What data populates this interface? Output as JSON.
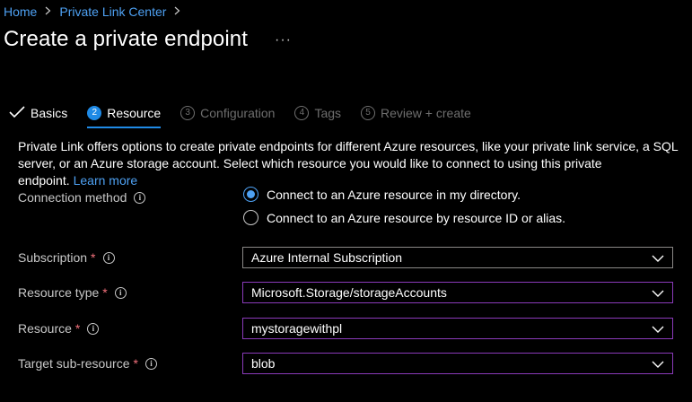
{
  "breadcrumb": {
    "home": "Home",
    "parent": "Private Link Center",
    "sep": ">"
  },
  "page": {
    "title": "Create a private endpoint",
    "more": "···"
  },
  "tabs": [
    {
      "label": "Basics",
      "step": "",
      "state": "done"
    },
    {
      "label": "Resource",
      "step": "2",
      "state": "active"
    },
    {
      "label": "Configuration",
      "step": "3",
      "state": "disabled"
    },
    {
      "label": "Tags",
      "step": "4",
      "state": "disabled"
    },
    {
      "label": "Review + create",
      "step": "5",
      "state": "disabled"
    }
  ],
  "description": {
    "text": "Private Link offers options to create private endpoints for different Azure resources, like your private link service, a SQL server, or an Azure storage account. Select which resource you would like to connect to using this private endpoint.",
    "link": "Learn more"
  },
  "connection_method": {
    "label": "Connection method",
    "options": [
      {
        "label": "Connect to an Azure resource in my directory.",
        "selected": true
      },
      {
        "label": "Connect to an Azure resource by resource ID or alias.",
        "selected": false
      }
    ]
  },
  "fields": {
    "subscription": {
      "label": "Subscription",
      "required": "*",
      "value": "Azure Internal Subscription"
    },
    "resource_type": {
      "label": "Resource type",
      "required": "*",
      "value": "Microsoft.Storage/storageAccounts"
    },
    "resource": {
      "label": "Resource",
      "required": "*",
      "value": "mystoragewithpl"
    },
    "target_sub_resource": {
      "label": "Target sub-resource",
      "required": "*",
      "value": "blob"
    }
  },
  "info_glyph": "i",
  "colors": {
    "accent": "#1f8ae6",
    "link": "#4ea1f3",
    "required": "#f1707b",
    "focus_border": "#8a3ab9",
    "background": "#000000"
  }
}
